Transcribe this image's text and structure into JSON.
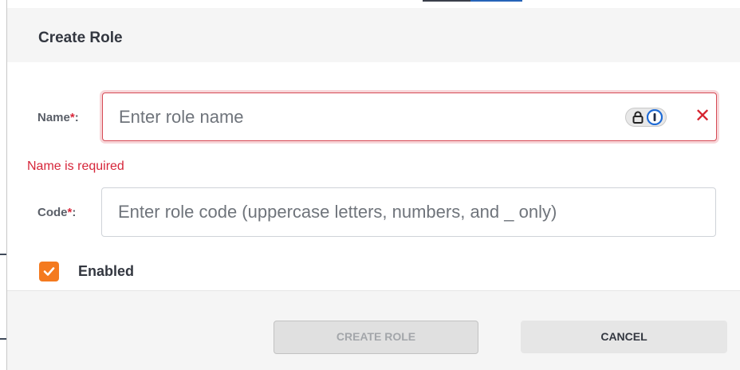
{
  "dialog": {
    "title": "Create Role"
  },
  "name_field": {
    "label": "Name",
    "required_mark": "*",
    "label_suffix": ":",
    "placeholder": "Enter role name",
    "value": "",
    "error": "Name is required",
    "state": "error"
  },
  "code_field": {
    "label": "Code",
    "required_mark": "*",
    "label_suffix": ":",
    "placeholder": "Enter role code (uppercase letters, numbers, and _ only)",
    "value": ""
  },
  "enabled_checkbox": {
    "label": "Enabled",
    "checked": true
  },
  "buttons": {
    "create_label": "CREATE ROLE",
    "create_disabled": true,
    "cancel_label": "CANCEL"
  },
  "icons": {
    "password_manager": "password-manager-icon",
    "clear": "clear-icon",
    "check": "check-icon"
  },
  "colors": {
    "error": "#d6263a",
    "accent": "#f47a1f",
    "header_bg": "#f5f5f5"
  }
}
